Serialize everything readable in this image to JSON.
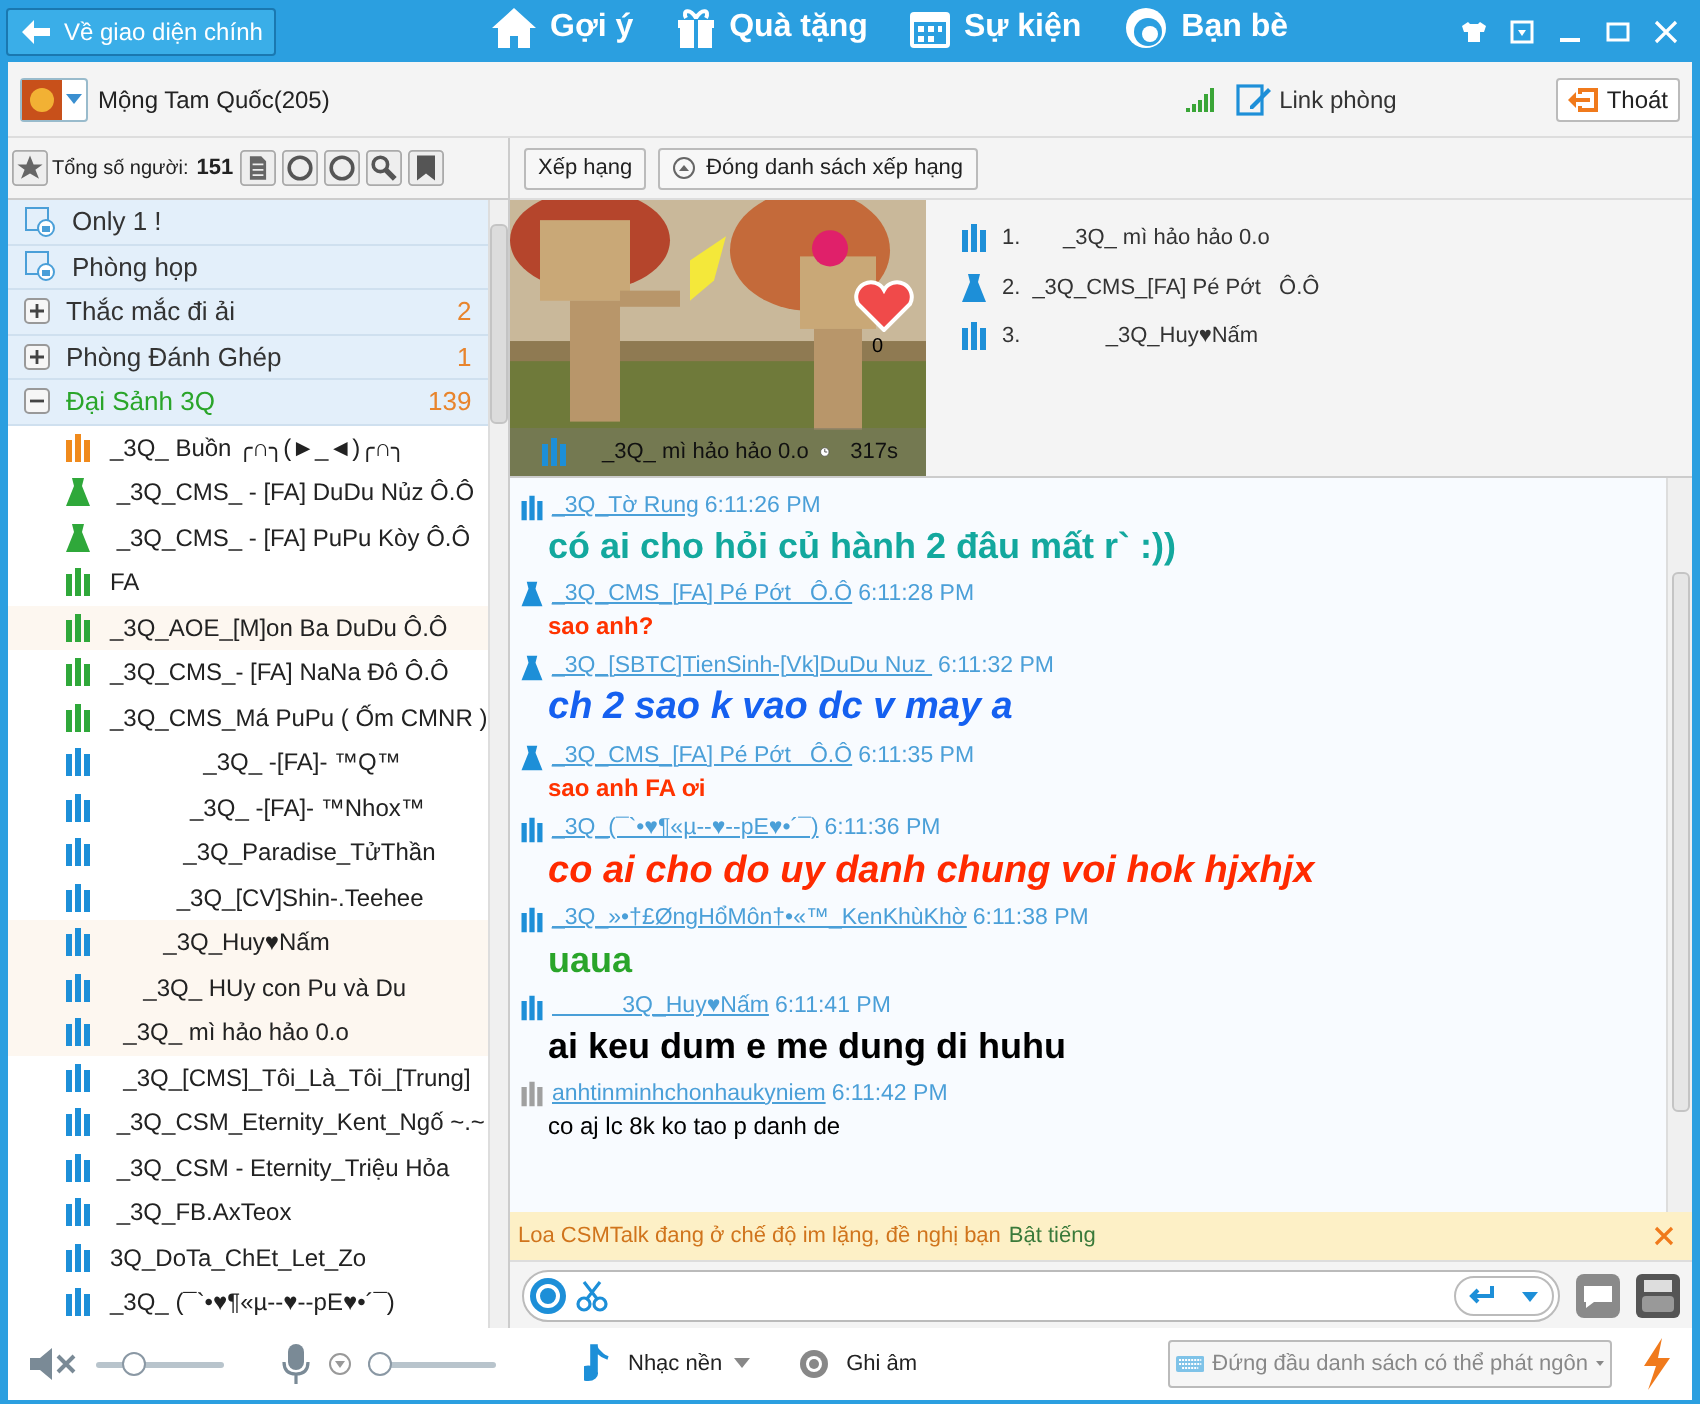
{
  "top_bar": {
    "back_button": "Về giao diện chính",
    "nav": [
      {
        "label": "Gợi ý",
        "kind": "home"
      },
      {
        "label": "Quà tặng",
        "kind": "gift"
      },
      {
        "label": "Sự kiện",
        "kind": "calendar"
      },
      {
        "label": "Bạn bè",
        "kind": "friends"
      }
    ]
  },
  "room_header": {
    "name": "Mộng Tam Quốc(205)",
    "link": "Link phòng",
    "exit": "Thoát"
  },
  "toolbar": {
    "total_label": "Tổng số người:",
    "total": "151",
    "rank_button": "Xếp hạng",
    "close_rank_button": "Đóng danh sách xếp hạng"
  },
  "rooms": [
    {
      "kind": "locked",
      "name": "Only 1 !"
    },
    {
      "kind": "locked",
      "name": "Phòng họp"
    },
    {
      "kind": "group",
      "name": "Thắc mắc đi ải",
      "count": "2",
      "expanded": false,
      "selected": false
    },
    {
      "kind": "group",
      "name": "Phòng Đánh Ghép",
      "count": "1",
      "expanded": false,
      "selected": false
    },
    {
      "kind": "group",
      "name": "Đại Sảnh 3Q",
      "count": "139",
      "expanded": true,
      "selected": true,
      "members": [
        {
          "name": "_3Q_ Buồn ╭∩╮(►_◄)╭∩╮",
          "kind": "man",
          "color": "#f08a1c",
          "highlighted": false
        },
        {
          "name": " _3Q_CMS_ - [FA] DuDu Nủz Ô.Ô",
          "kind": "woman",
          "color": "#2fa83a",
          "highlighted": false
        },
        {
          "name": " _3Q_CMS_ - [FA] PuPu Kòy Ô.Ô",
          "kind": "woman",
          "color": "#2fa83a",
          "highlighted": false
        },
        {
          "name": "FA",
          "kind": "man",
          "color": "#2fa83a",
          "highlighted": false
        },
        {
          "name": "_3Q_AOE_[M]on Ba DuDu Ô.Ô",
          "kind": "man",
          "color": "#2fa83a",
          "highlighted": true
        },
        {
          "name": "_3Q_CMS_- [FA] NaNa Đô Ô.Ô",
          "kind": "man",
          "color": "#2fa83a",
          "highlighted": false
        },
        {
          "name": "_3Q_CMS_Má PuPu ( Ốm CMNR )",
          "kind": "man",
          "color": "#2fa83a",
          "highlighted": false
        },
        {
          "name": "              _3Q_ -[FA]- ™Q™",
          "kind": "man",
          "color": "#1d8fd8",
          "highlighted": false
        },
        {
          "name": "            _3Q_ -[FA]- ™Nhox™",
          "kind": "man",
          "color": "#1d8fd8",
          "highlighted": false
        },
        {
          "name": "           _3Q_Paradise_TửThần",
          "kind": "man",
          "color": "#1d8fd8",
          "highlighted": false
        },
        {
          "name": "          _3Q_[CV]Shin-.Teehee",
          "kind": "man",
          "color": "#1d8fd8",
          "highlighted": false
        },
        {
          "name": "        _3Q_Huy♥Nấm",
          "kind": "man",
          "color": "#1d8fd8",
          "highlighted": true
        },
        {
          "name": "     _3Q_ HUy con Pu và Du",
          "kind": "man",
          "color": "#1d8fd8",
          "highlighted": true
        },
        {
          "name": "  _3Q_ mì hảo hảo 0.o",
          "kind": "man",
          "color": "#1d8fd8",
          "highlighted": true
        },
        {
          "name": "  _3Q_[CMS]_Tôi_Là_Tôi_[Trung]",
          "kind": "man",
          "color": "#1d8fd8",
          "highlighted": false
        },
        {
          "name": " _3Q_CSM_Eternity_Kent_Ngố ~.~",
          "kind": "man",
          "color": "#1d8fd8",
          "highlighted": false
        },
        {
          "name": " _3Q_CSM - Eternity_Triệu Hỏa",
          "kind": "man",
          "color": "#1d8fd8",
          "highlighted": false
        },
        {
          "name": " _3Q_FB.AxTeox",
          "kind": "man",
          "color": "#1d8fd8",
          "highlighted": false
        },
        {
          "name": "3Q_DoTa_ChEt_Let_Zo",
          "kind": "man",
          "color": "#1d8fd8",
          "highlighted": false
        },
        {
          "name": "_3Q_ (¯`•♥¶«µ--♥--pE♥•´¯)",
          "kind": "man",
          "color": "#1d8fd8",
          "highlighted": false
        }
      ]
    }
  ],
  "stage": {
    "kind": "picture",
    "performer": "_3Q_ mì hảo hảo 0.o",
    "heart_count": "0",
    "timer": "317s"
  },
  "ranking": [
    {
      "rank": "1.",
      "name": "     _3Q_ mì hảo hảo 0.o",
      "kind": "man"
    },
    {
      "rank": "2.",
      "name": "_3Q_CMS_[FA] Pé Pớt   Ô.Ô",
      "kind": "woman"
    },
    {
      "rank": "3.",
      "name": "            _3Q_Huy♥Nấm",
      "kind": "man"
    }
  ],
  "chat": [
    {
      "kind": "man",
      "color": "#1d8fd8",
      "user": "_3Q_Tờ Rung",
      "time": "6:11:26 PM",
      "message": {
        "kind": "large",
        "text": "có ai cho hỏi củ hành 2 đâu mất r` :))",
        "color": "#13a89e"
      }
    },
    {
      "kind": "woman",
      "color": "#1d8fd8",
      "user": "_3Q_CMS_[FA] Pé Pớt   Ô.Ô",
      "time": "6:11:28 PM",
      "message": {
        "kind": "small",
        "text": "sao anh?",
        "color": "#ff3300"
      }
    },
    {
      "kind": "woman",
      "color": "#1d8fd8",
      "user": "_3Q_[SBTC]TienSinh-[Vk]DuDu Nuz ",
      "time": "6:11:32 PM",
      "message": {
        "kind": "large-italic",
        "text": "ch 2 sao k vao dc v may a",
        "color": "#1560f0"
      }
    },
    {
      "kind": "woman",
      "color": "#1d8fd8",
      "user": "_3Q_CMS_[FA] Pé Pớt   Ô.Ô",
      "time": "6:11:35 PM",
      "message": {
        "kind": "small",
        "text": "sao anh FA ơi",
        "color": "#ff3300"
      }
    },
    {
      "kind": "man",
      "color": "#1d8fd8",
      "user": "_3Q_(¯`•♥¶«µ--♥--pE♥•´¯)",
      "time": "6:11:36 PM",
      "message": {
        "kind": "large-italic",
        "text": "co ai cho do uy danh chung voi hok hjxhjx",
        "color": "#ff2a00"
      }
    },
    {
      "kind": "man",
      "color": "#1d8fd8",
      "user": "_3Q_»•†£ØngHổMôn†•«™_KenKhùKhờ",
      "time": "6:11:38 PM",
      "message": {
        "kind": "large",
        "text": "uaua",
        "color": "#2aa52a"
      }
    },
    {
      "kind": "man",
      "color": "#1d8fd8",
      "user": "           3Q_Huy♥Nấm",
      "time": "6:11:41 PM",
      "message": {
        "kind": "large",
        "text": "ai keu dum e me dung di huhu",
        "color": "#000000"
      }
    },
    {
      "kind": "man",
      "color": "#a0a0a0",
      "user": "anhtinminhchonhaukyniem",
      "time": "6:11:42 PM",
      "message": {
        "kind": "plain",
        "text": "co aj lc 8k ko tao p danh de",
        "color": "#000000"
      }
    }
  ],
  "notice": {
    "text": "Loa CSMTalk đang ở chế độ im lặng, đề nghị bạn",
    "action": "Bật tiếng"
  },
  "bottom_bar": {
    "speaker_muted": true,
    "speaker": {
      "level": 0.3
    },
    "microphone": {
      "level": 0.1
    },
    "music": "Nhạc nền",
    "record": "Ghi âm",
    "speak_mode": "Đứng đầu danh sách có thể phát ngôn"
  }
}
